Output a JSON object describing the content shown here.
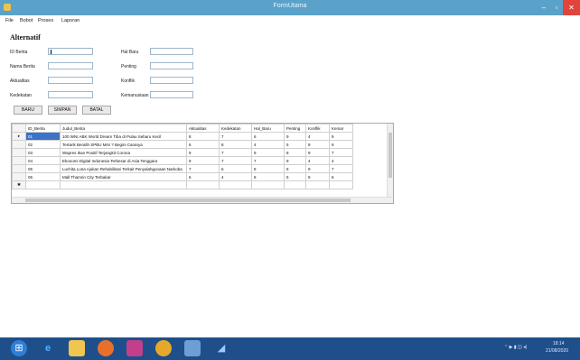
{
  "window": {
    "title": "FormUtama",
    "min_glyph": "–",
    "max_glyph": "▫",
    "close_glyph": "✕"
  },
  "menu": [
    "File",
    "Bobot",
    "Proses",
    "Laporan"
  ],
  "section_title": "Alternatif",
  "fields_left": [
    {
      "label": "ID Berita",
      "value": ""
    },
    {
      "label": "Nama Berita",
      "value": ""
    },
    {
      "label": "Aktualitas",
      "value": ""
    },
    {
      "label": "Kedekatan",
      "value": ""
    }
  ],
  "fields_right": [
    {
      "label": "Hal Baru",
      "value": ""
    },
    {
      "label": "Penting",
      "value": ""
    },
    {
      "label": "Konflik",
      "value": ""
    },
    {
      "label": "Kemanusiaan",
      "value": ""
    }
  ],
  "buttons": {
    "new": "BARU",
    "save": "SIMPAN",
    "cancel": "BATAL"
  },
  "table": {
    "columns": [
      "ID_Berita",
      "Judul_Berita",
      "Aktualitas",
      "Kedekatan",
      "Hal_Baru",
      "Penting",
      "Konflik",
      "Kemar"
    ],
    "rows": [
      [
        "01",
        "100 WNI ABK World Dream Tiba di Pulau Sebaru Kecil",
        "8",
        "7",
        "6",
        "9",
        "4",
        "9"
      ],
      [
        "02",
        "Tertarik Beralih SPBU Mini ? Begini Caranya",
        "6",
        "8",
        "4",
        "5",
        "9",
        "9"
      ],
      [
        "03",
        "Wapres Ikan Positif Terjangkit Corona",
        "9",
        "7",
        "9",
        "8",
        "9",
        "7"
      ],
      [
        "04",
        "Ekonomi Digital Indonesia Terbesar di   Asia Tenggara",
        "9",
        "7",
        "7",
        "9",
        "4",
        "4"
      ],
      [
        "05",
        "Luchita Luna Ajukan Rehabilitasi Terkait Penyalahgunaan Narkoba",
        "7",
        "6",
        "8",
        "6",
        "9",
        "7"
      ],
      [
        "06",
        "Mall Thamrin City Terbakar",
        "6",
        "4",
        "8",
        "5",
        "9",
        "6"
      ]
    ],
    "current_row_marker": "▸",
    "new_row_marker": "✱"
  },
  "taskbar": {
    "icons": [
      "start-orb",
      "internet-explorer",
      "file-explorer",
      "firefox",
      "calculator",
      "paint",
      "visual-studio",
      "app"
    ],
    "tray_icons": "⌃ ▶ ▮ ◫ ◂)",
    "time": "18:14",
    "date": "21/08/2020"
  }
}
